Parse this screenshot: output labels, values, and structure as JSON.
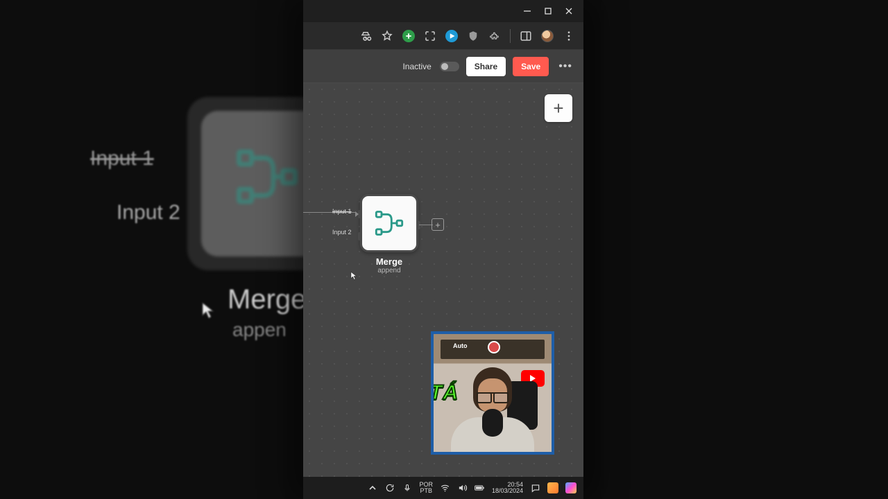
{
  "bg": {
    "input1": "Input 1",
    "input2": "Input 2",
    "title": "Merge",
    "sub": "appen"
  },
  "window": {
    "min": "—",
    "max": "▢",
    "close": "✕"
  },
  "appbar": {
    "status": "Inactive",
    "share": "Share",
    "save": "Save",
    "more": "•••"
  },
  "canvas": {
    "input1": "Input 1",
    "input2": "Input 2",
    "node_title": "Merge",
    "node_sub": "append"
  },
  "webcam": {
    "brand": "Auto",
    "caption": "TÁ"
  },
  "taskbar": {
    "lang1": "POR",
    "lang2": "PTB",
    "time": "20:54",
    "date": "18/03/2024"
  },
  "colors": {
    "accent": "#ff5a4f",
    "link_blue": "#1e5ea8",
    "caption_green": "#5cff2e"
  }
}
